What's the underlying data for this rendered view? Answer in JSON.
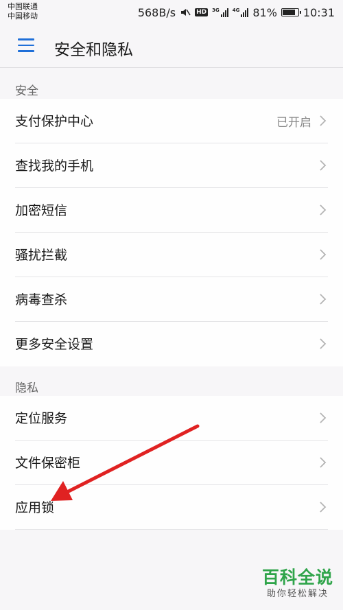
{
  "status_bar": {
    "carrier_1": "中国联通",
    "carrier_2": "中国移动",
    "speed": "568B/s",
    "hd": "HD",
    "net_1": "3G",
    "net_2": "4G",
    "battery": "81%",
    "battery_level": 0.81,
    "time": "10:31"
  },
  "header": {
    "title": "安全和隐私"
  },
  "sections": [
    {
      "label": "安全",
      "items": [
        {
          "label": "支付保护中心",
          "value": "已开启"
        },
        {
          "label": "查找我的手机"
        },
        {
          "label": "加密短信"
        },
        {
          "label": "骚扰拦截"
        },
        {
          "label": "病毒查杀"
        },
        {
          "label": "更多安全设置"
        }
      ]
    },
    {
      "label": "隐私",
      "items": [
        {
          "label": "定位服务"
        },
        {
          "label": "文件保密柜"
        },
        {
          "label": "应用锁"
        }
      ]
    }
  ],
  "watermark": {
    "title": "百科全说",
    "subtitle": "助你轻松解决"
  },
  "colors": {
    "accent": "#1f6fd8",
    "arrow": "#e02222",
    "watermark": "#2fa44a"
  }
}
